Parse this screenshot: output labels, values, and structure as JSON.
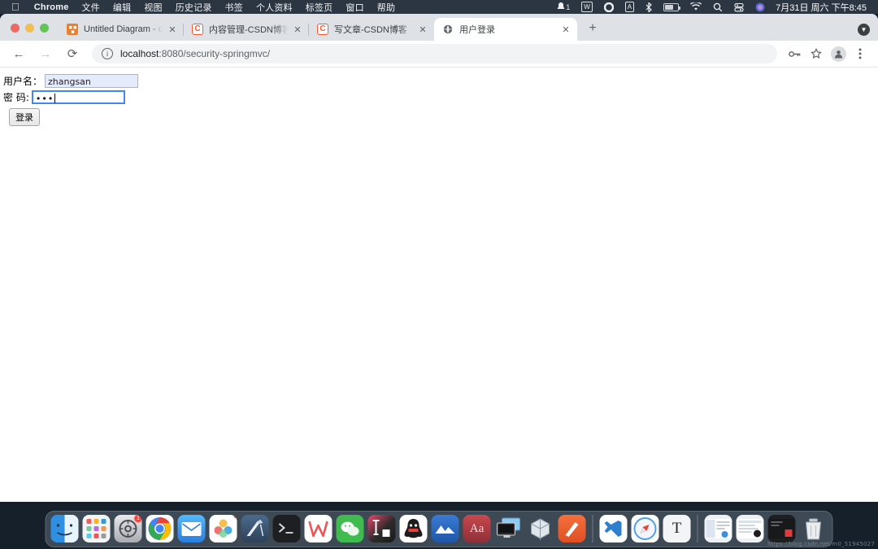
{
  "menubar": {
    "apple_icon": "apple-logo",
    "items": [
      {
        "label": "Chrome",
        "bold": true
      },
      {
        "label": "文件",
        "bold": false
      },
      {
        "label": "编辑",
        "bold": false
      },
      {
        "label": "视图",
        "bold": false
      },
      {
        "label": "历史记录",
        "bold": false
      },
      {
        "label": "书签",
        "bold": false
      },
      {
        "label": "个人资料",
        "bold": false
      },
      {
        "label": "标签页",
        "bold": false
      },
      {
        "label": "窗口",
        "bold": false
      },
      {
        "label": "帮助",
        "bold": false
      }
    ],
    "status_icons": [
      {
        "name": "notification-bell-icon",
        "badge": "1"
      },
      {
        "name": "wps-icon",
        "glyph": "W"
      },
      {
        "name": "onedrive-icon",
        "glyph": "O"
      },
      {
        "name": "input-source-icon",
        "glyph": "A"
      },
      {
        "name": "bluetooth-icon",
        "glyph": "✳"
      },
      {
        "name": "battery-icon",
        "glyph": ""
      },
      {
        "name": "wifi-icon",
        "glyph": ""
      },
      {
        "name": "spotlight-search-icon",
        "glyph": ""
      },
      {
        "name": "control-center-icon",
        "glyph": ""
      },
      {
        "name": "siri-icon",
        "glyph": ""
      }
    ],
    "clock": "7月31日 周六 下午8:45"
  },
  "browser": {
    "window_controls": [
      "close",
      "minimize",
      "zoom"
    ],
    "tabs": [
      {
        "title": "Untitled Diagram - diagrams.n",
        "favicon": "diagrams-net-icon",
        "active": false
      },
      {
        "title": "内容管理-CSDN博客",
        "favicon": "csdn-icon",
        "active": false
      },
      {
        "title": "写文章-CSDN博客",
        "favicon": "csdn-icon",
        "active": false
      },
      {
        "title": "用户登录",
        "favicon": "globe-icon",
        "active": true
      }
    ],
    "new_tab_label": "+",
    "close_tab_label": "✕",
    "update_indicator": "update-available-icon",
    "toolbar": {
      "back_label": "←",
      "forward_label": "→",
      "reload_label": "⟳",
      "info_label": "i",
      "url_host": "localhost",
      "url_path": ":8080/security-springmvc/",
      "url_full": "localhost:8080/security-springmvc/",
      "password_key_icon": "key-icon",
      "bookmark_icon": "star-icon",
      "profile_icon": "avatar-icon",
      "menu_icon": "three-dots-menu-icon"
    }
  },
  "page": {
    "username_label": "用户名：",
    "username_value": "zhangsan",
    "password_label": "密  码:",
    "password_value": "•••",
    "login_button_label": "登录"
  },
  "watermark": "https://blog.csdn.net/m0_51945027",
  "dock": {
    "items": [
      {
        "name": "finder-icon",
        "glyph": "",
        "running": true,
        "badge": ""
      },
      {
        "name": "launchpad-icon",
        "glyph": "",
        "running": false,
        "badge": ""
      },
      {
        "name": "system-preferences-icon",
        "glyph": "",
        "running": false,
        "badge": "1"
      },
      {
        "name": "chrome-icon",
        "glyph": "",
        "running": true,
        "badge": ""
      },
      {
        "name": "mail-icon",
        "glyph": "",
        "running": false,
        "badge": ""
      },
      {
        "name": "photos-icon",
        "glyph": "",
        "running": false,
        "badge": ""
      },
      {
        "name": "preview-icon",
        "glyph": "",
        "running": false,
        "badge": ""
      },
      {
        "name": "terminal-icon",
        "glyph": "",
        "running": false,
        "badge": ""
      },
      {
        "name": "wps-office-icon",
        "glyph": "W",
        "running": false,
        "badge": ""
      },
      {
        "name": "wechat-icon",
        "glyph": "",
        "running": false,
        "badge": ""
      },
      {
        "name": "intellij-idea-icon",
        "glyph": "IJ",
        "running": true,
        "badge": ""
      },
      {
        "name": "qq-icon",
        "glyph": "",
        "running": false,
        "badge": ""
      },
      {
        "name": "navicat-icon",
        "glyph": "",
        "running": false,
        "badge": ""
      },
      {
        "name": "dictionary-icon",
        "glyph": "Aa",
        "running": false,
        "badge": ""
      },
      {
        "name": "remote-desktop-icon",
        "glyph": "",
        "running": false,
        "badge": ""
      },
      {
        "name": "virtualbox-icon",
        "glyph": "",
        "running": false,
        "badge": ""
      },
      {
        "name": "typora-icon",
        "glyph": "",
        "running": false,
        "badge": ""
      },
      {
        "name": "vscode-icon",
        "glyph": "",
        "running": false,
        "badge": ""
      },
      {
        "name": "safari-icon",
        "glyph": "",
        "running": false,
        "badge": ""
      },
      {
        "name": "texshop-icon",
        "glyph": "T",
        "running": false,
        "badge": ""
      },
      {
        "name": "stack-window-1-icon",
        "glyph": "",
        "running": false,
        "badge": ""
      },
      {
        "name": "stack-window-2-icon",
        "glyph": "",
        "running": false,
        "badge": ""
      },
      {
        "name": "stack-window-3-icon",
        "glyph": "",
        "running": false,
        "badge": ""
      },
      {
        "name": "trash-icon",
        "glyph": "",
        "running": false,
        "badge": ""
      }
    ]
  }
}
